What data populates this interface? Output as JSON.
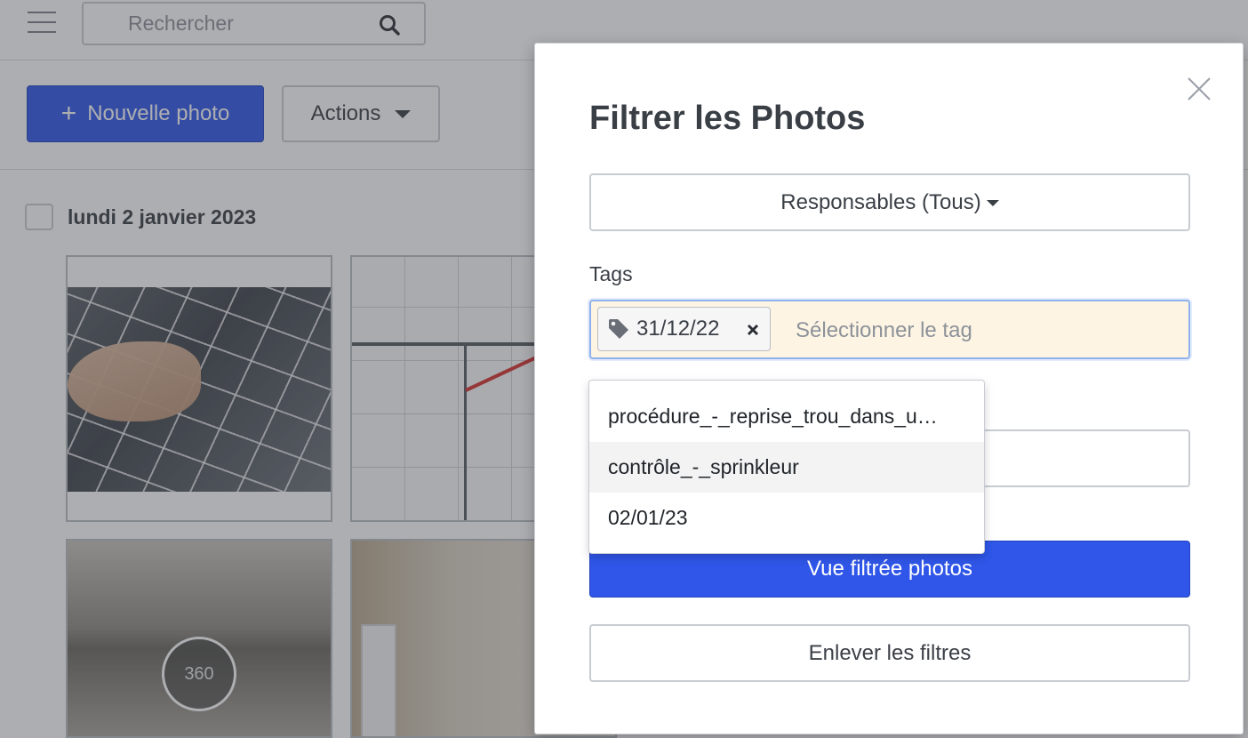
{
  "header": {
    "search": {
      "placeholder": "Rechercher"
    }
  },
  "toolbar": {
    "new_photo_label": "Nouvelle photo",
    "actions_label": "Actions"
  },
  "gallery": {
    "date_label": "lundi 2 janvier 2023",
    "pano_badge": "360"
  },
  "modal": {
    "title": "Filtrer les Photos",
    "responsables_label": "Responsables (Tous)",
    "tags_label": "Tags",
    "selected_tag": "31/12/22",
    "tag_placeholder": "Sélectionner le tag",
    "dropdown_options": [
      "procédure_-_reprise_trou_dans_u…",
      "contrôle_-_sprinkleur",
      "02/01/23"
    ],
    "apply_label": "Vue filtrée photos",
    "clear_label": "Enlever les filtres"
  },
  "colors": {
    "primary": "#2f56e8",
    "focus_border": "#8fb2ef",
    "input_focus_bg": "#fdf4e3"
  }
}
